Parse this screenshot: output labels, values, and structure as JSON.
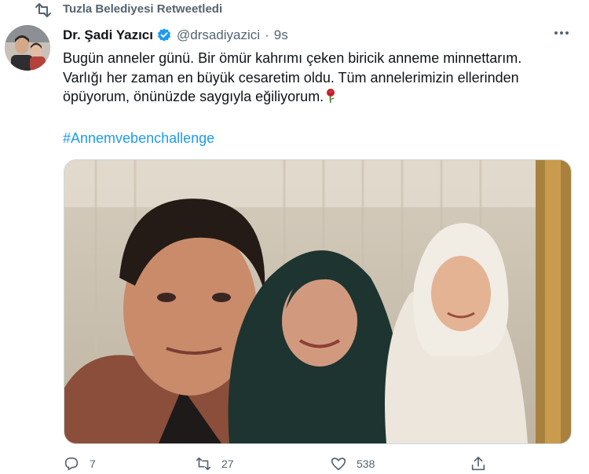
{
  "retweet_header": {
    "text": "Tuzla Belediyesi Retweetledi",
    "icon": "retweet-icon"
  },
  "author": {
    "name": "Dr. Şadi Yazıcı",
    "handle": "@drsadiyazici",
    "separator": "·",
    "time": "9s",
    "verified": true
  },
  "tweet": {
    "lines": [
      "Bugün anneler günü. Bir ömür kahrımı çeken biricik anneme minnettarım.",
      "Varlığı her zaman en büyük cesaretim oldu. Tüm annelerimizin ellerinden",
      "öpüyorum, önünüzde saygıyla eğiliyorum."
    ],
    "emoji": "rose",
    "hashtag": "#Annemvebenchallenge"
  },
  "actions": {
    "reply_count": "7",
    "retweet_count": "27",
    "like_count": "538"
  },
  "colors": {
    "text": "#0f1419",
    "secondary": "#536471",
    "link": "#1d9bf0",
    "verified": "#1d9bf0"
  }
}
